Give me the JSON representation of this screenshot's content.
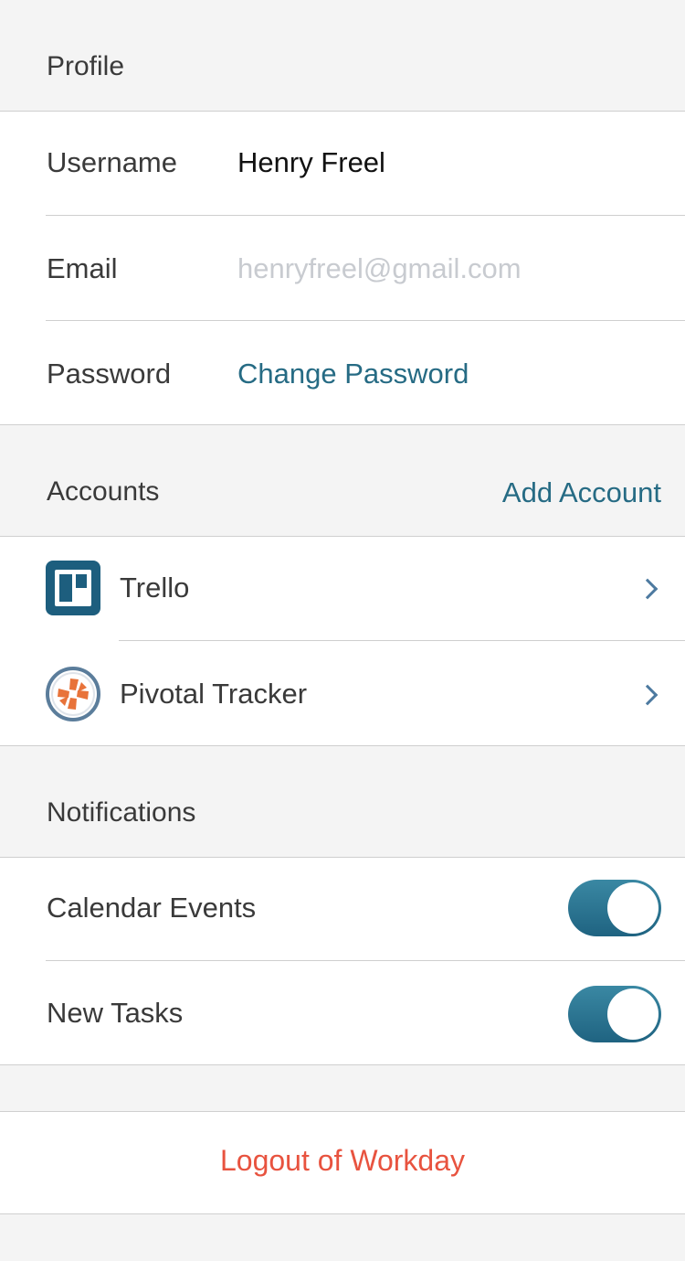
{
  "profile": {
    "header": "Profile",
    "username_label": "Username",
    "username_value": "Henry Freel",
    "email_label": "Email",
    "email_placeholder": "henryfreel@gmail.com",
    "password_label": "Password",
    "password_action": "Change Password"
  },
  "accounts": {
    "header": "Accounts",
    "add_action": "Add Account",
    "items": [
      {
        "label": "Trello",
        "icon": "trello-icon"
      },
      {
        "label": "Pivotal Tracker",
        "icon": "pivotal-tracker-icon"
      }
    ]
  },
  "notifications": {
    "header": "Notifications",
    "items": [
      {
        "label": "Calendar Events",
        "enabled": true
      },
      {
        "label": "New Tasks",
        "enabled": true
      }
    ]
  },
  "logout": {
    "label": "Logout of Workday"
  },
  "colors": {
    "accent": "#266b84",
    "toggle_on": "#2a7491",
    "danger": "#e8533f",
    "placeholder": "#c8cbd0",
    "divider": "#cfcfcf"
  }
}
